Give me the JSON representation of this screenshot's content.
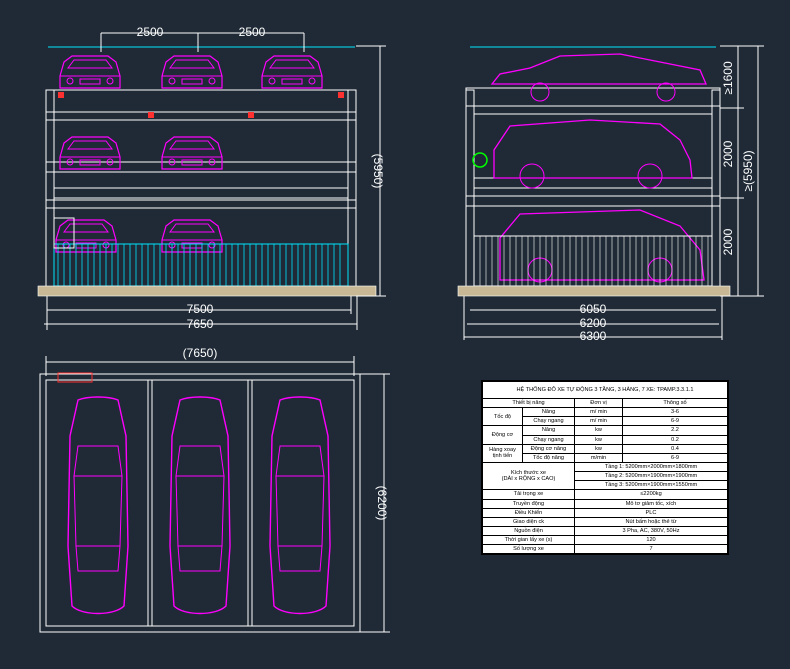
{
  "front_view": {
    "dims_top": [
      "2500",
      "2500"
    ],
    "dims_bottom": [
      "7500",
      "7650"
    ],
    "dim_right": "(5950)"
  },
  "side_view": {
    "dims_right": [
      "≥1600",
      "2000",
      "2000"
    ],
    "dim_right_total": "≥(5950)",
    "dims_bottom": [
      "6050",
      "6200",
      "6300"
    ]
  },
  "plan_view": {
    "dim_top": "(7650)",
    "dim_right": "(6200)"
  },
  "spec": {
    "title": "HỆ THỐNG ĐỖ XE TỰ ĐỘNG 3 TẦNG, 3 HÀNG, 7 XE: TPAMP.3.3.1.1",
    "headers": [
      "Thiết bị nâng",
      "Đơn vị",
      "Thông số"
    ],
    "speed_group": "Tốc độ",
    "speed_rows": [
      {
        "label": "Nâng",
        "unit": "m/ min",
        "value": "3-6"
      },
      {
        "label": "Chạy ngang",
        "unit": "m/ min",
        "value": "6-9"
      }
    ],
    "motor_group": "Động cơ",
    "motor_rows": [
      {
        "label": "Nâng",
        "unit": "kw",
        "value": "2.2"
      },
      {
        "label": "Chạy ngang",
        "unit": "kw",
        "value": "0.2"
      }
    ],
    "rotate_group": "Hàng xoay tịnh tiến",
    "rotate_rows": [
      {
        "label": "Động cơ nâng",
        "unit": "kw",
        "value": "0.4"
      },
      {
        "label": "Tốc độ nâng",
        "unit": "m/min",
        "value": "6-9"
      }
    ],
    "size_group": "Kích thước xe\n(DÀI x RỘNG x CAO)",
    "size_rows": [
      "Tầng 1: 5200mm×2000mm×1800mm",
      "Tầng 2: 5200mm×1900mm×1900mm",
      "Tầng 3: 5200mm×1900mm×1550mm"
    ],
    "other_rows": [
      {
        "label": "Tải trọng xe",
        "value": "≤2200kg"
      },
      {
        "label": "Truyền động",
        "value": "Mô tơ giảm tốc, xích"
      },
      {
        "label": "Điều Khiển",
        "value": "PLC"
      },
      {
        "label": "Giao diện ck",
        "value": "Nút bấm hoặc thẻ từ"
      },
      {
        "label": "Nguồn điện",
        "value": "3 Pha, AC, 380V, 50Hz"
      },
      {
        "label": "Thời gian lấy xe (s)",
        "value": "120"
      },
      {
        "label": "Số lượng xe",
        "value": "7"
      }
    ]
  },
  "colors": {
    "background": "#1f2a36",
    "car": "#ff00ff",
    "dimension": "#ffffff",
    "fence": "#00e5ff",
    "structure": "#ffffff",
    "accent": "#ff3030"
  }
}
